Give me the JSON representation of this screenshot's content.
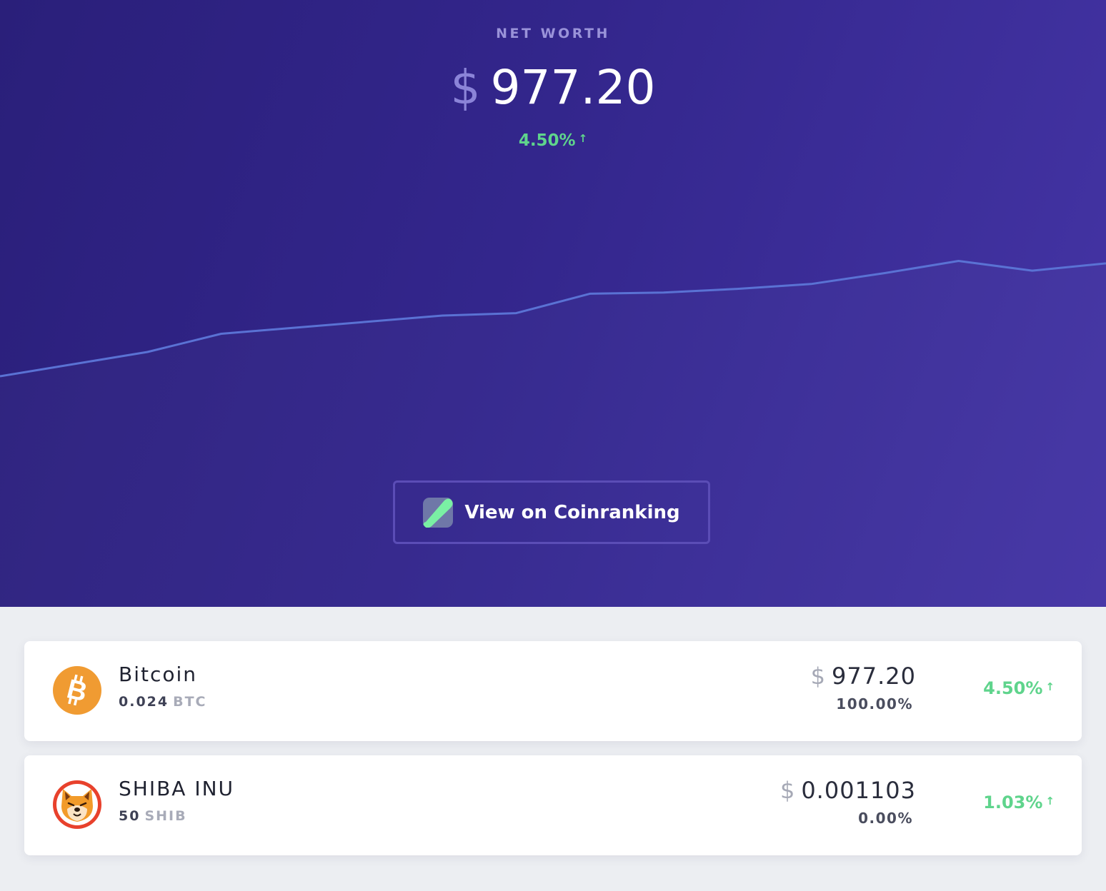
{
  "header": {
    "label": "NET WORTH",
    "currency": "$",
    "value": "977.20",
    "change": "4.50%",
    "change_arrow": "↑"
  },
  "chart_data": {
    "type": "line",
    "x": [
      0,
      1,
      2,
      3,
      4,
      5,
      6,
      7,
      8,
      9,
      10,
      11,
      12,
      13,
      14,
      15
    ],
    "series": [
      {
        "values": [
          890,
          900,
          910,
          925,
          930,
          935,
          940,
          942,
          958,
          959,
          962,
          966,
          975,
          985,
          977,
          983
        ]
      }
    ],
    "title": "",
    "xlabel": "",
    "ylabel": "",
    "ylim": [
      700,
      1200
    ],
    "grid": false,
    "line_color": "#5a72d4"
  },
  "button": {
    "label": "View on Coinranking",
    "icon": "coinranking-logo-icon"
  },
  "holdings": [
    {
      "name": "Bitcoin",
      "amount": "0.024",
      "symbol": "BTC",
      "currency": "$",
      "value": "977.20",
      "share": "100.00%",
      "change": "4.50%",
      "change_arrow": "↑",
      "icon": "bitcoin-icon",
      "icon_color": "#f09b32"
    },
    {
      "name": "SHIBA INU",
      "amount": "50",
      "symbol": "SHIB",
      "currency": "$",
      "value": "0.001103",
      "share": "0.00%",
      "change": "1.03%",
      "change_arrow": "↑",
      "icon": "shiba-inu-icon",
      "icon_color": "#e8412c"
    }
  ],
  "colors": {
    "positive": "#5fd48c",
    "hero_start": "#2a1f7a",
    "hero_end": "#4535a6"
  }
}
